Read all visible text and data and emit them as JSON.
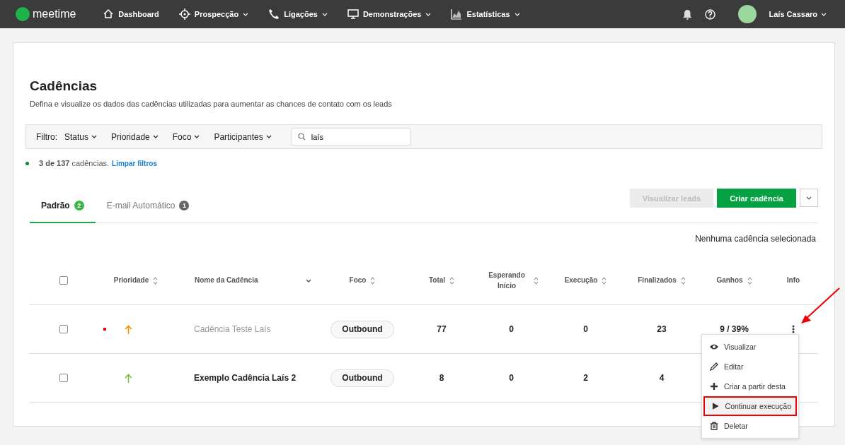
{
  "navbar": {
    "logo": "meetime",
    "items": [
      {
        "label": "Dashboard",
        "dropdown": false
      },
      {
        "label": "Prospecção",
        "dropdown": true
      },
      {
        "label": "Ligações",
        "dropdown": true
      },
      {
        "label": "Demonstrações",
        "dropdown": true
      },
      {
        "label": "Estatísticas",
        "dropdown": true
      }
    ],
    "user": {
      "name": "Laís Cassaro"
    }
  },
  "page": {
    "title": "Cadências",
    "subtitle": "Defina e visualize os dados das cadências utilizadas para aumentar as chances de contato com os leads"
  },
  "filter": {
    "label": "Filtro:",
    "dropdowns": [
      "Status",
      "Prioridade",
      "Foco",
      "Participantes"
    ],
    "search_value": "laís"
  },
  "summary": {
    "text": "**3 de 137** cadências.",
    "link": "Limpar filtros"
  },
  "tabs": [
    {
      "label": "Padrão",
      "count": "2",
      "selected": true
    },
    {
      "label": "E-mail Automático",
      "count": "1",
      "selected": false
    }
  ],
  "actions": [
    {
      "label": "Visualizar leads",
      "disabled": true
    },
    {
      "label": "Criar cadência",
      "disabled": false
    }
  ],
  "selection_note": "Nenhuma cadência selecionada",
  "table": {
    "columns": [
      {
        "label": "Prioridade",
        "kind": "sortable"
      },
      {
        "label": "Nome da Cadência",
        "kind": "sorted"
      },
      {
        "label": "Foco",
        "kind": "sortable"
      },
      {
        "label": "Total",
        "kind": "sortable"
      },
      {
        "label": "Esperando Início",
        "kind": "sortable"
      },
      {
        "label": "Execução",
        "kind": "sortable"
      },
      {
        "label": "Finalizados",
        "kind": "sortable"
      },
      {
        "label": "Ganhos",
        "kind": "sortable"
      },
      {
        "label": "Info",
        "kind": "plain"
      }
    ],
    "header_checked": false,
    "rows": [
      {
        "checked": false,
        "paused": true,
        "color": "#f39200",
        "name": "Cadência Teste Laís",
        "focus": "Outbound",
        "total": "77",
        "waiting": "0",
        "running": "0",
        "finished": "23",
        "won": "9 / 39%"
      },
      {
        "checked": false,
        "paused": false,
        "color": "#7bc043",
        "name": "Exemplo Cadência Laís 2",
        "focus": "Outbound",
        "total": "8",
        "waiting": "0",
        "running": "2",
        "finished": "4"
      }
    ]
  },
  "row_menu": {
    "items": [
      {
        "label": "Visualizar",
        "highlighted": false
      },
      {
        "label": "Editar",
        "highlighted": false
      },
      {
        "label": "Criar a partir desta",
        "highlighted": false
      },
      {
        "label": "Continuar execução",
        "highlighted": true
      },
      {
        "label": "Deletar",
        "highlighted": false
      }
    ]
  }
}
